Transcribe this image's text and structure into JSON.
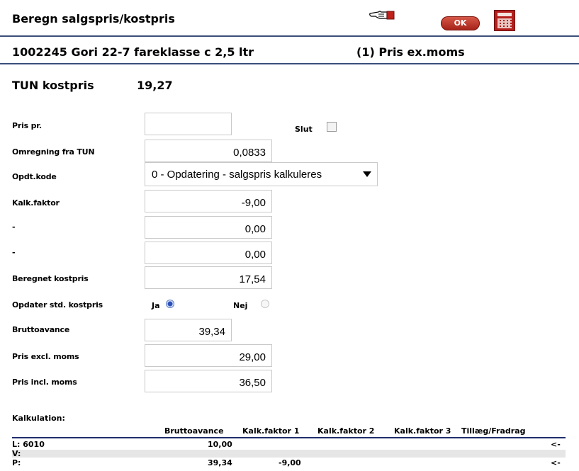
{
  "header": {
    "title": "Beregn salgspris/kostpris",
    "ok_label": "OK"
  },
  "item": {
    "line": "1002245  Gori 22-7 fareklasse c 2,5 ltr",
    "price_type": "(1) Pris ex.moms"
  },
  "tun": {
    "label": "TUN kostpris",
    "value": "19,27"
  },
  "form": {
    "pris_pr": {
      "label": "Pris pr.",
      "value": ""
    },
    "slut_label": "Slut",
    "omregning": {
      "label": "Omregning fra TUN",
      "value": "0,0833"
    },
    "opdt_kode": {
      "label": "Opdt.kode",
      "selected": "0 - Opdatering - salgspris kalkuleres"
    },
    "kalk_faktor": {
      "label": "Kalk.faktor",
      "value": "-9,00"
    },
    "dash1": {
      "label": "-",
      "value": "0,00"
    },
    "dash2": {
      "label": "-",
      "value": "0,00"
    },
    "beregnet": {
      "label": "Beregnet kostpris",
      "value": "17,54"
    },
    "opdater_std": {
      "label": "Opdater std. kostpris",
      "ja": "Ja",
      "nej": "Nej",
      "selected": "Ja"
    },
    "bruttoavance": {
      "label": "Bruttoavance",
      "value": "39,34"
    },
    "pris_excl": {
      "label": "Pris excl. moms",
      "value": "29,00"
    },
    "pris_incl": {
      "label": "Pris incl. moms",
      "value": "36,50"
    }
  },
  "kalkulation": {
    "title": "Kalkulation:",
    "columns": [
      "Bruttoavance",
      "Kalk.faktor 1",
      "Kalk.faktor 2",
      "Kalk.faktor 3",
      "Tillæg/Fradrag"
    ],
    "rows": [
      {
        "label": "L: 6010",
        "bruttoavance": "10,00",
        "kf1": "",
        "arrow": "<-"
      },
      {
        "label": "V:",
        "bruttoavance": "",
        "kf1": "",
        "arrow": ""
      },
      {
        "label": "P:",
        "bruttoavance": "39,34",
        "kf1": "-9,00",
        "arrow": "<-"
      }
    ]
  },
  "icons": {
    "pointer": "pointing-hand-icon",
    "calculator": "calculator-icon"
  },
  "colors": {
    "rule": "#3a4f7a",
    "ok_button": "#b8291e",
    "calculator": "#b41f1c"
  }
}
